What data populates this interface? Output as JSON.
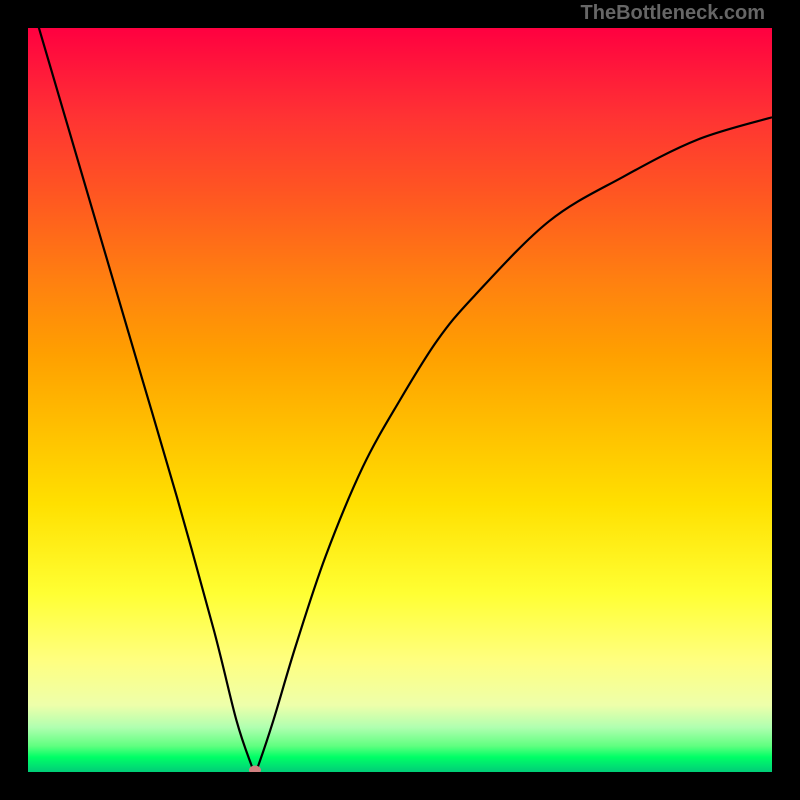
{
  "watermark": "TheBottleneck.com",
  "chart_data": {
    "type": "line",
    "title": "",
    "xlabel": "",
    "ylabel": "",
    "xlim": [
      0,
      1
    ],
    "ylim": [
      0,
      1
    ],
    "series": [
      {
        "name": "bottleneck-curve",
        "x": [
          0.0,
          0.05,
          0.1,
          0.15,
          0.2,
          0.25,
          0.28,
          0.3,
          0.305,
          0.31,
          0.33,
          0.36,
          0.4,
          0.45,
          0.5,
          0.55,
          0.6,
          0.7,
          0.8,
          0.9,
          1.0
        ],
        "values": [
          1.05,
          0.88,
          0.71,
          0.54,
          0.37,
          0.19,
          0.07,
          0.01,
          0.0,
          0.01,
          0.07,
          0.17,
          0.29,
          0.41,
          0.5,
          0.58,
          0.64,
          0.74,
          0.8,
          0.85,
          0.88
        ]
      }
    ],
    "marker": {
      "x": 0.305,
      "y": 0.003
    },
    "gradient_colors": {
      "top": "#ff0040",
      "mid_upper": "#ff8010",
      "mid": "#ffe000",
      "mid_lower": "#ffff80",
      "bottom": "#00e670"
    }
  }
}
